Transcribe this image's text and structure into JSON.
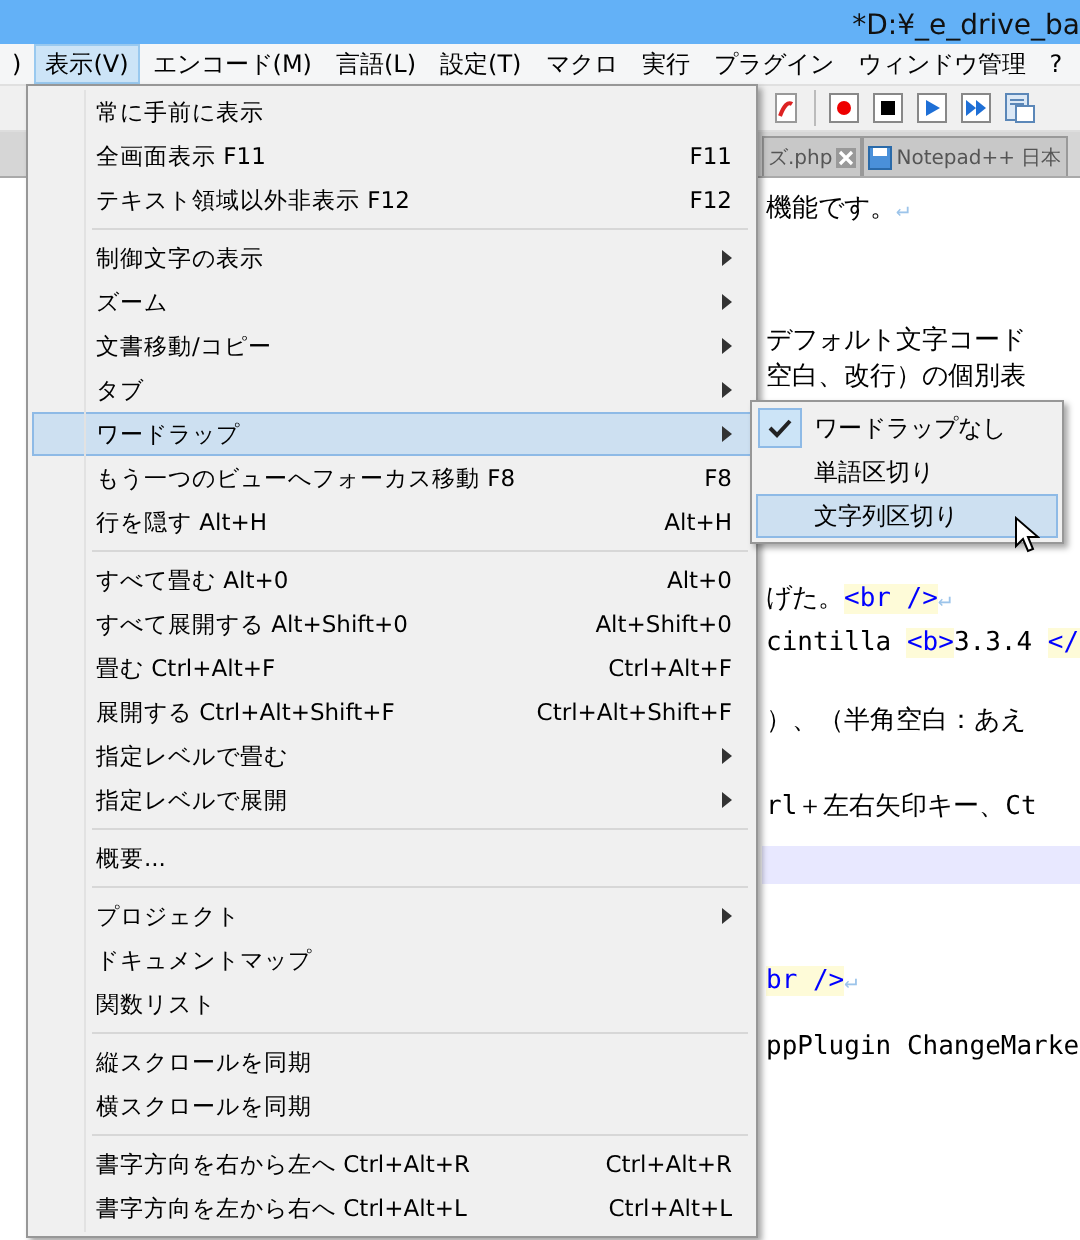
{
  "window": {
    "title": "*D:¥_e_drive_ba"
  },
  "menubar": [
    {
      "label": ")",
      "selected": false
    },
    {
      "label": "表示(V)",
      "selected": true
    },
    {
      "label": "エンコード(M)",
      "selected": false
    },
    {
      "label": "言語(L)",
      "selected": false
    },
    {
      "label": "設定(T)",
      "selected": false
    },
    {
      "label": "マクロ",
      "selected": false
    },
    {
      "label": "実行",
      "selected": false
    },
    {
      "label": "プラグイン",
      "selected": false
    },
    {
      "label": "ウィンドウ管理",
      "selected": false
    },
    {
      "label": "?",
      "selected": false
    }
  ],
  "tabs": [
    {
      "label": "ズ.php",
      "selected": false
    },
    {
      "label": "Notepad++ 日本",
      "selected": false
    }
  ],
  "editor": {
    "lines": [
      {
        "current": false,
        "segments": [
          {
            "kind": "text",
            "text": "機能です。"
          },
          {
            "kind": "eol",
            "text": "↵"
          }
        ]
      },
      {
        "current": false,
        "segments": [
          {
            "kind": "text",
            "text": "デフォルト文字コード"
          }
        ]
      },
      {
        "current": false,
        "segments": [
          {
            "kind": "text",
            "text": "空白、改行）の個別表"
          }
        ]
      },
      {
        "current": false,
        "segments": [
          {
            "kind": "text",
            "text": "げた。"
          },
          {
            "kind": "tag",
            "text": "<br />"
          },
          {
            "kind": "eol",
            "text": "↵"
          }
        ]
      },
      {
        "current": false,
        "segments": [
          {
            "kind": "text",
            "text": "cintilla "
          },
          {
            "kind": "tag",
            "text": "<b>"
          },
          {
            "kind": "text",
            "text": "3.3.4 "
          },
          {
            "kind": "tag",
            "text": "</"
          }
        ]
      },
      {
        "current": false,
        "segments": [
          {
            "kind": "text",
            "text": "）、（半角空白：あえ"
          }
        ]
      },
      {
        "current": false,
        "segments": [
          {
            "kind": "text",
            "text": "rl＋左右矢印キー、Ct"
          }
        ]
      },
      {
        "current": true
      },
      {
        "current": false,
        "segments": [
          {
            "kind": "tag",
            "text": "br />"
          },
          {
            "kind": "eol",
            "text": "↵"
          }
        ]
      },
      {
        "current": false,
        "segments": [
          {
            "kind": "text",
            "text": "ppPlugin ChangeMarke"
          }
        ]
      }
    ]
  },
  "menu": {
    "sections": [
      [
        {
          "label": "常に手前に表示",
          "submenu": false,
          "selected": false
        },
        {
          "label": "全画面表示 F11",
          "shortcut": "F11",
          "submenu": false,
          "selected": false
        },
        {
          "label": "テキスト領域以外非表示 F12",
          "shortcut": "F12",
          "submenu": false,
          "selected": false
        }
      ],
      [
        {
          "label": "制御文字の表示",
          "submenu": true,
          "selected": false
        },
        {
          "label": "ズーム",
          "submenu": true,
          "selected": false
        },
        {
          "label": "文書移動/コピー",
          "submenu": true,
          "selected": false
        },
        {
          "label": "タブ",
          "submenu": true,
          "selected": false
        },
        {
          "label": "ワードラップ",
          "submenu": true,
          "selected": true
        },
        {
          "label": "もう一つのビューへフォーカス移動 F8",
          "shortcut": "F8",
          "submenu": false,
          "selected": false
        },
        {
          "label": "行を隠す Alt+H",
          "shortcut": "Alt+H",
          "submenu": false,
          "selected": false
        }
      ],
      [
        {
          "label": "すべて畳む Alt+0",
          "shortcut": "Alt+0",
          "submenu": false,
          "selected": false
        },
        {
          "label": "すべて展開する Alt+Shift+0",
          "shortcut": "Alt+Shift+0",
          "submenu": false,
          "selected": false
        },
        {
          "label": "畳む Ctrl+Alt+F",
          "shortcut": "Ctrl+Alt+F",
          "submenu": false,
          "selected": false
        },
        {
          "label": "展開する Ctrl+Alt+Shift+F",
          "shortcut": "Ctrl+Alt+Shift+F",
          "submenu": false,
          "selected": false
        },
        {
          "label": "指定レベルで畳む",
          "submenu": true,
          "selected": false
        },
        {
          "label": "指定レベルで展開",
          "submenu": true,
          "selected": false
        }
      ],
      [
        {
          "label": "概要...",
          "submenu": false,
          "selected": false
        }
      ],
      [
        {
          "label": "プロジェクト",
          "submenu": true,
          "selected": false
        },
        {
          "label": "ドキュメントマップ",
          "submenu": false,
          "selected": false
        },
        {
          "label": "関数リスト",
          "submenu": false,
          "selected": false
        }
      ],
      [
        {
          "label": "縦スクロールを同期",
          "submenu": false,
          "selected": false
        },
        {
          "label": "横スクロールを同期",
          "submenu": false,
          "selected": false
        }
      ],
      [
        {
          "label": "書字方向を右から左へ Ctrl+Alt+R",
          "shortcut": "Ctrl+Alt+R",
          "submenu": false,
          "selected": false
        },
        {
          "label": "書字方向を左から右へ Ctrl+Alt+L",
          "shortcut": "Ctrl+Alt+L",
          "submenu": false,
          "selected": false
        }
      ]
    ]
  },
  "submenu": {
    "items": [
      {
        "label": "ワードラップなし",
        "checked": true,
        "selected": false
      },
      {
        "label": "単語区切り",
        "checked": false,
        "selected": false
      },
      {
        "label": "文字列区切り",
        "checked": false,
        "selected": true
      }
    ]
  }
}
